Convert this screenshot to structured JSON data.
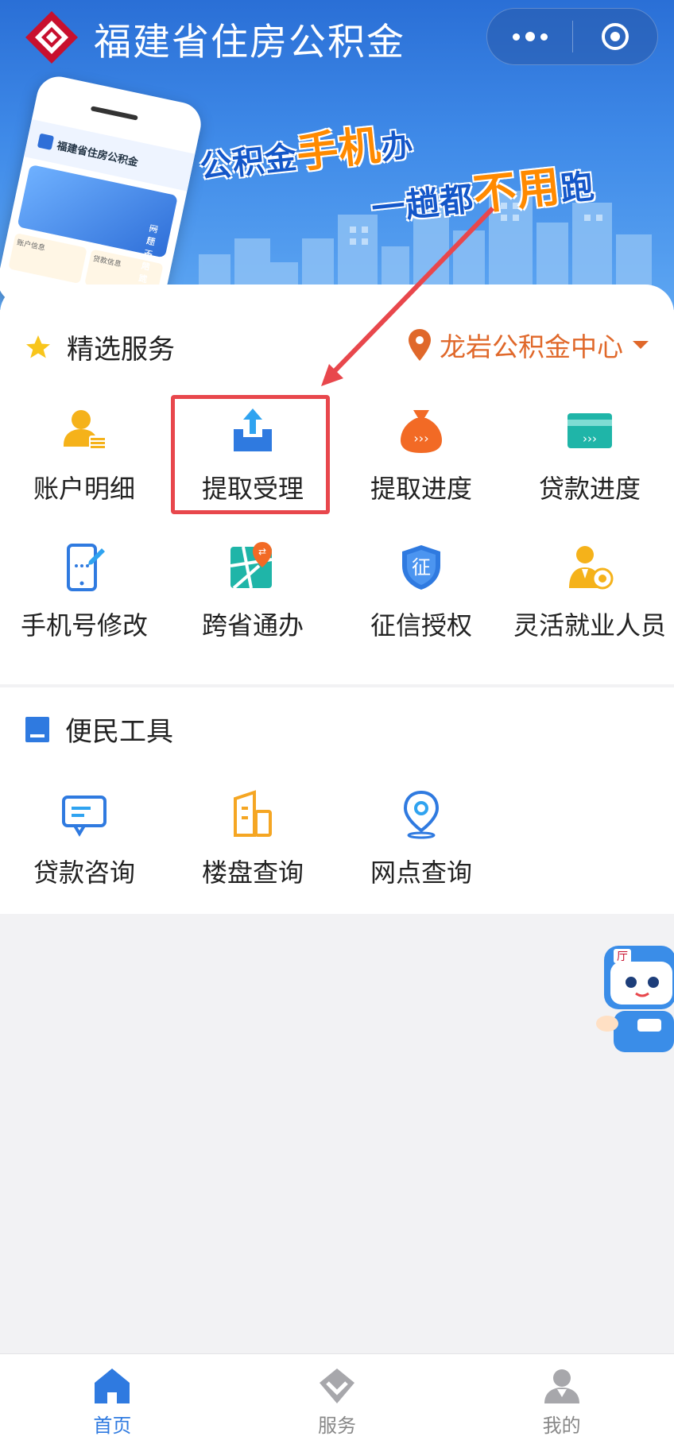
{
  "header": {
    "title": "福建省住房公积金",
    "more_icon": "more-dots-icon",
    "close_icon": "target-close-icon"
  },
  "banner": {
    "slogan_line1_a": "公积金",
    "slogan_line1_b": "手机",
    "slogan_line1_c": "办",
    "slogan_line2_a": "一趟都",
    "slogan_line2_b": "不用",
    "slogan_line2_c": "跑",
    "phone_title": "福建省住房公积金",
    "phone_banner_line1": "网厅一站式服务",
    "phone_banner_line2": "一趟不用跑",
    "phone_tile1": "账户信息",
    "phone_tile2": "贷款信息"
  },
  "featured": {
    "title": "精选服务",
    "region": "龙岩公积金中心",
    "items": [
      {
        "label": "账户明细",
        "icon": "account-detail-icon"
      },
      {
        "label": "提取受理",
        "icon": "withdraw-upload-icon"
      },
      {
        "label": "提取进度",
        "icon": "withdraw-progress-bag-icon"
      },
      {
        "label": "贷款进度",
        "icon": "loan-progress-card-icon"
      },
      {
        "label": "手机号修改",
        "icon": "phone-edit-icon"
      },
      {
        "label": "跨省通办",
        "icon": "cross-province-map-icon"
      },
      {
        "label": "征信授权",
        "icon": "credit-shield-icon"
      },
      {
        "label": "灵活就业人员",
        "icon": "flexible-employee-icon"
      }
    ]
  },
  "tools": {
    "title": "便民工具",
    "items": [
      {
        "label": "贷款咨询",
        "icon": "chat-consult-icon"
      },
      {
        "label": "楼盘查询",
        "icon": "building-icon"
      },
      {
        "label": "网点查询",
        "icon": "location-pin-icon"
      }
    ]
  },
  "tabbar": {
    "tabs": [
      {
        "label": "首页",
        "icon": "home-icon",
        "active": true
      },
      {
        "label": "服务",
        "icon": "service-diamond-icon",
        "active": false
      },
      {
        "label": "我的",
        "icon": "user-icon",
        "active": false
      }
    ]
  },
  "colors": {
    "accent_blue": "#2f7ae0",
    "region_orange": "#e0682a",
    "highlight_red": "#e8474c",
    "icon_yellow": "#f5b21a",
    "icon_orange": "#f26a25",
    "icon_teal": "#1fb5a8"
  }
}
